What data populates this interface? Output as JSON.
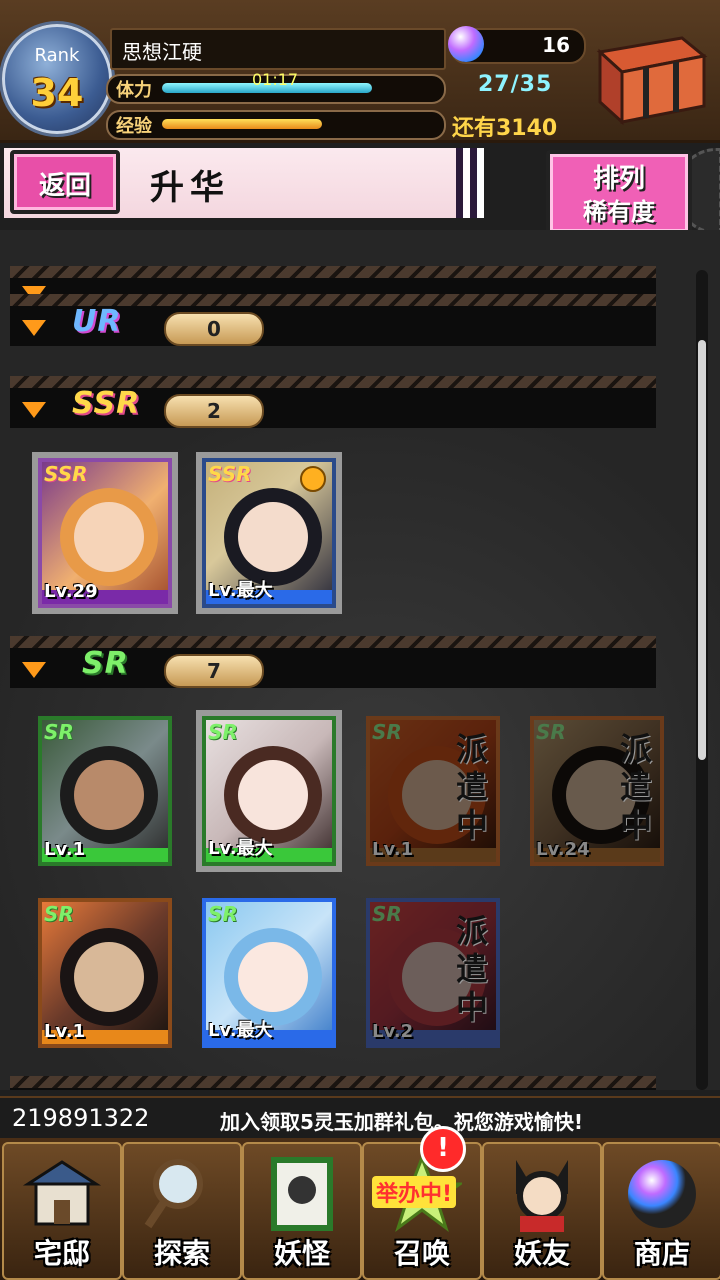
{
  "header": {
    "rank_label": "Rank",
    "rank_value": "34",
    "player_name": "思想江硬",
    "stamina_label": "体力",
    "stamina_timer": "01:17",
    "stamina_value": "27/35",
    "stamina_fraction": 0.77,
    "exp_label": "经验",
    "exp_fraction": 0.55,
    "exp_remaining": "还有3140",
    "gems": "16"
  },
  "titlebar": {
    "back_label": "返回",
    "title": "升华",
    "sort_line1": "排列",
    "sort_line2": "稀有度"
  },
  "categories": [
    {
      "rarity": "UR",
      "count": "0",
      "color": "#6fb8ff"
    },
    {
      "rarity": "SSR",
      "count": "2",
      "color": "#ffd84a"
    },
    {
      "rarity": "SR",
      "count": "7",
      "color": "#7ef06a"
    }
  ],
  "cards": {
    "ssr": [
      {
        "rarity": "SSR",
        "level": "Lv.29"
      },
      {
        "rarity": "SSR",
        "level": "Lv.最大"
      }
    ],
    "sr": [
      {
        "rarity": "SR",
        "level": "Lv.1"
      },
      {
        "rarity": "SR",
        "level": "Lv.最大"
      },
      {
        "rarity": "SR",
        "level": "Lv.1",
        "status": "派遣中"
      },
      {
        "rarity": "SR",
        "level": "Lv.24",
        "status": "派遣中"
      },
      {
        "rarity": "SR",
        "level": "Lv.1"
      },
      {
        "rarity": "SR",
        "level": "Lv.最大"
      },
      {
        "rarity": "SR",
        "level": "Lv.2",
        "status": "派遣中"
      }
    ]
  },
  "ticker": {
    "id": "219891322",
    "message": "加入领取5灵玉加群礼包。祝您游戏愉快!"
  },
  "nav": {
    "items": [
      {
        "label": "宅邸",
        "icon": "house-icon"
      },
      {
        "label": "探索",
        "icon": "magnifier-icon"
      },
      {
        "label": "妖怪",
        "icon": "scroll-icon"
      },
      {
        "label": "召唤",
        "icon": "summon-icon"
      },
      {
        "label": "妖友",
        "icon": "friend-icon"
      },
      {
        "label": "商店",
        "icon": "orb-icon"
      }
    ],
    "badge": "!",
    "event_tag": "举办中!"
  }
}
